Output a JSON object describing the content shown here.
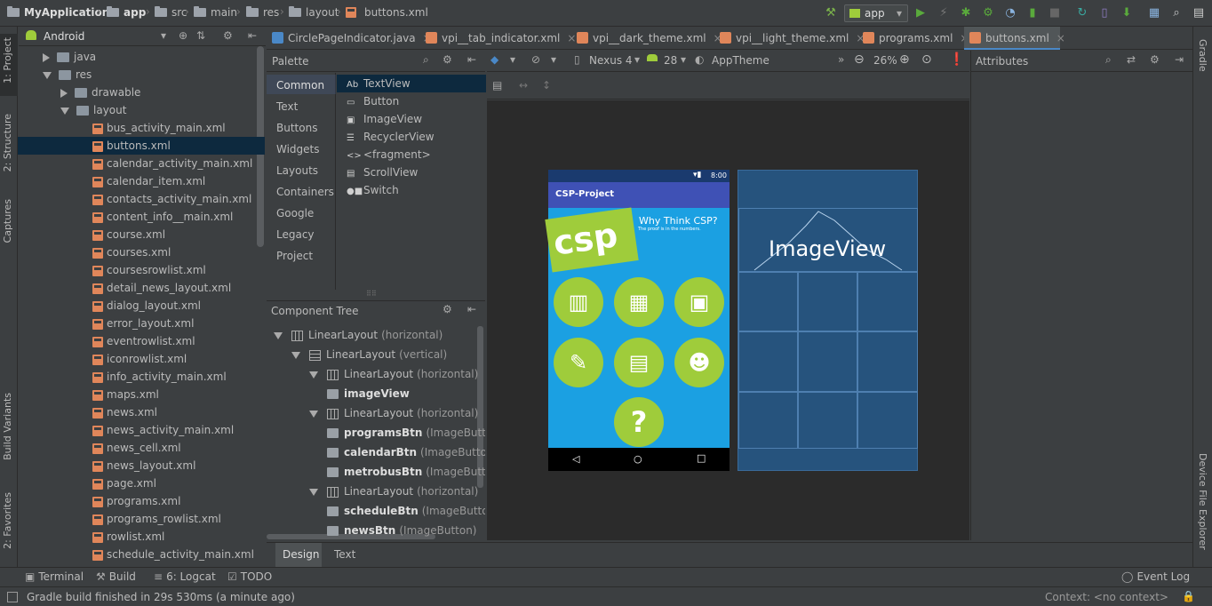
{
  "breadcrumb": {
    "project": "MyApplication",
    "items": [
      "app",
      "src",
      "main",
      "res",
      "layout",
      "buttons.xml"
    ]
  },
  "run_config": {
    "value": "app"
  },
  "left_tabs": {
    "project": "1: Project",
    "structure": "2: Structure",
    "captures": "Captures",
    "build_variants": "Build Variants",
    "favorites": "2: Favorites"
  },
  "right_tabs": {
    "gradle": "Gradle",
    "device_explorer": "Device File Explorer"
  },
  "project_panel": {
    "view": "Android",
    "rows": [
      {
        "label": "java",
        "type": "folder",
        "state": "collapsed"
      },
      {
        "label": "res",
        "type": "folder",
        "state": "expanded"
      },
      {
        "label": "drawable",
        "type": "folder",
        "state": "collapsed"
      },
      {
        "label": "layout",
        "type": "folder",
        "state": "expanded"
      },
      {
        "label": "bus_activity_main.xml",
        "type": "xml"
      },
      {
        "label": "buttons.xml",
        "type": "xml",
        "selected": true
      },
      {
        "label": "calendar_activity_main.xml",
        "type": "xml"
      },
      {
        "label": "calendar_item.xml",
        "type": "xml"
      },
      {
        "label": "contacts_activity_main.xml",
        "type": "xml"
      },
      {
        "label": "content_info__main.xml",
        "type": "xml"
      },
      {
        "label": "course.xml",
        "type": "xml"
      },
      {
        "label": "courses.xml",
        "type": "xml"
      },
      {
        "label": "coursesrowlist.xml",
        "type": "xml"
      },
      {
        "label": "detail_news_layout.xml",
        "type": "xml"
      },
      {
        "label": "dialog_layout.xml",
        "type": "xml"
      },
      {
        "label": "error_layout.xml",
        "type": "xml"
      },
      {
        "label": "eventrowlist.xml",
        "type": "xml"
      },
      {
        "label": "iconrowlist.xml",
        "type": "xml"
      },
      {
        "label": "info_activity_main.xml",
        "type": "xml"
      },
      {
        "label": "maps.xml",
        "type": "xml"
      },
      {
        "label": "news.xml",
        "type": "xml"
      },
      {
        "label": "news_activity_main.xml",
        "type": "xml"
      },
      {
        "label": "news_cell.xml",
        "type": "xml"
      },
      {
        "label": "news_layout.xml",
        "type": "xml"
      },
      {
        "label": "page.xml",
        "type": "xml"
      },
      {
        "label": "programs.xml",
        "type": "xml"
      },
      {
        "label": "programs_rowlist.xml",
        "type": "xml"
      },
      {
        "label": "rowlist.xml",
        "type": "xml"
      },
      {
        "label": "schedule_activity_main.xml",
        "type": "xml"
      }
    ]
  },
  "editor_tabs": [
    {
      "label": "CirclePageIndicator.java",
      "color": "#4a88c7"
    },
    {
      "label": "vpi__tab_indicator.xml",
      "color": "#e0865a"
    },
    {
      "label": "vpi__dark_theme.xml",
      "color": "#e0865a"
    },
    {
      "label": "vpi__light_theme.xml",
      "color": "#e0865a"
    },
    {
      "label": "programs.xml",
      "color": "#e0865a"
    },
    {
      "label": "buttons.xml",
      "color": "#e0865a",
      "active": true
    }
  ],
  "palette": {
    "title": "Palette",
    "categories": [
      "Common",
      "Text",
      "Buttons",
      "Widgets",
      "Layouts",
      "Containers",
      "Google",
      "Legacy",
      "Project"
    ],
    "selected_category": "Common",
    "items": [
      {
        "icon": "Ab",
        "label": "TextView"
      },
      {
        "icon": "▭",
        "label": "Button"
      },
      {
        "icon": "▣",
        "label": "ImageView"
      },
      {
        "icon": "☰",
        "label": "RecyclerView"
      },
      {
        "icon": "<>",
        "label": "<fragment>"
      },
      {
        "icon": "▤",
        "label": "ScrollView"
      },
      {
        "icon": "●■",
        "label": "Switch"
      }
    ]
  },
  "component_tree": {
    "title": "Component Tree",
    "rows": [
      {
        "name": "LinearLayout",
        "detail": "(horizontal)",
        "kind": "h"
      },
      {
        "name": "LinearLayout",
        "detail": "(vertical)",
        "kind": "v"
      },
      {
        "name": "LinearLayout",
        "detail": "(horizontal)",
        "kind": "h"
      },
      {
        "name": "imageView",
        "detail": "",
        "kind": "img"
      },
      {
        "name": "LinearLayout",
        "detail": "(horizontal)",
        "kind": "h"
      },
      {
        "name": "programsBtn",
        "detail": "(ImageButto",
        "kind": "img"
      },
      {
        "name": "calendarBtn",
        "detail": "(ImageButto",
        "kind": "img"
      },
      {
        "name": "metrobusBtn",
        "detail": "(ImageButto",
        "kind": "img"
      },
      {
        "name": "LinearLayout",
        "detail": "(horizontal)",
        "kind": "h"
      },
      {
        "name": "scheduleBtn",
        "detail": "(ImageButto",
        "kind": "img"
      },
      {
        "name": "newsBtn",
        "detail": "(ImageButton)",
        "kind": "img"
      }
    ]
  },
  "design_toolbar": {
    "device": "Nexus 4",
    "api": "28",
    "theme": "AppTheme",
    "zoom": "26%"
  },
  "attributes": {
    "title": "Attributes"
  },
  "phone_preview": {
    "time": "8:00",
    "app_title": "CSP-Project",
    "logo_text": "csp",
    "banner_title": "Why Think CSP?",
    "banner_sub": "The proof is in the numbers.",
    "help_glyph": "?"
  },
  "blueprint": {
    "label": "ImageView"
  },
  "bottom_tabs": {
    "design": "Design",
    "text": "Text"
  },
  "tool_windows": {
    "terminal": "Terminal",
    "build": "Build",
    "logcat": "6: Logcat",
    "todo": "TODO",
    "event_log": "Event Log"
  },
  "status": {
    "message": "Gradle build finished in 29s 530ms (a minute ago)",
    "context": "Context: <no context>"
  }
}
